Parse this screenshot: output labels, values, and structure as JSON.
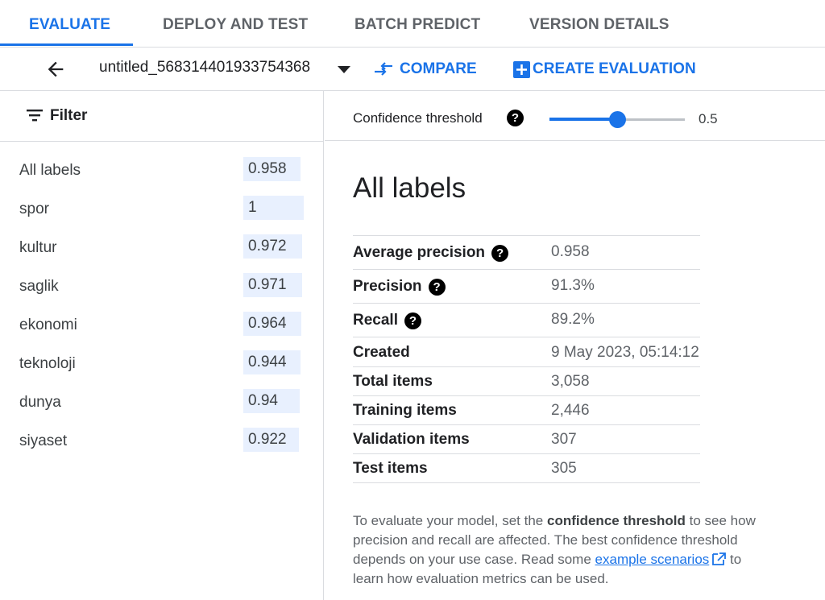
{
  "tabs": [
    {
      "label": "EVALUATE",
      "active": true
    },
    {
      "label": "DEPLOY AND TEST",
      "active": false
    },
    {
      "label": "BATCH PREDICT",
      "active": false
    },
    {
      "label": "VERSION DETAILS",
      "active": false
    }
  ],
  "toolbar": {
    "model_name": "untitled_568314401933754368",
    "compare_label": "COMPARE",
    "create_label": "CREATE EVALUATION"
  },
  "filter": {
    "label": "Filter"
  },
  "labels": [
    {
      "name": "All labels",
      "score": "0.958"
    },
    {
      "name": "spor",
      "score": "1"
    },
    {
      "name": "kultur",
      "score": "0.972"
    },
    {
      "name": "saglik",
      "score": "0.971"
    },
    {
      "name": "ekonomi",
      "score": "0.964"
    },
    {
      "name": "teknoloji",
      "score": "0.944"
    },
    {
      "name": "dunya",
      "score": "0.94"
    },
    {
      "name": "siyaset",
      "score": "0.922"
    }
  ],
  "threshold": {
    "label": "Confidence threshold",
    "value": "0.5",
    "fraction": 0.5
  },
  "section_title": "All labels",
  "metrics": [
    {
      "name": "Average precision",
      "value": "0.958",
      "help": true
    },
    {
      "name": "Precision",
      "value": "91.3%",
      "help": true
    },
    {
      "name": "Recall",
      "value": "89.2%",
      "help": true
    },
    {
      "name": "Created",
      "value": "9 May 2023, 05:14:12",
      "help": false
    },
    {
      "name": "Total items",
      "value": "3,058",
      "help": false
    },
    {
      "name": "Training items",
      "value": "2,446",
      "help": false
    },
    {
      "name": "Validation items",
      "value": "307",
      "help": false
    },
    {
      "name": "Test items",
      "value": "305",
      "help": false
    }
  ],
  "help_text": {
    "part1": "To evaluate your model, set the ",
    "bold": "confidence threshold",
    "part2": " to see how precision and recall are affected. The best confidence threshold depends on your use case. Read some ",
    "link": "example scenarios",
    "part3": " to learn how evaluation metrics can be used."
  },
  "icons": {
    "back": "arrow-left-icon",
    "dropdown": "caret-down-icon",
    "compare": "compare-arrows-icon",
    "create": "add-box-icon",
    "filter": "filter-list-icon",
    "help": "help-circle-icon",
    "external": "open-in-new-icon"
  },
  "colors": {
    "accent": "#1a73e8",
    "score_bg": "#e8f0fe"
  }
}
